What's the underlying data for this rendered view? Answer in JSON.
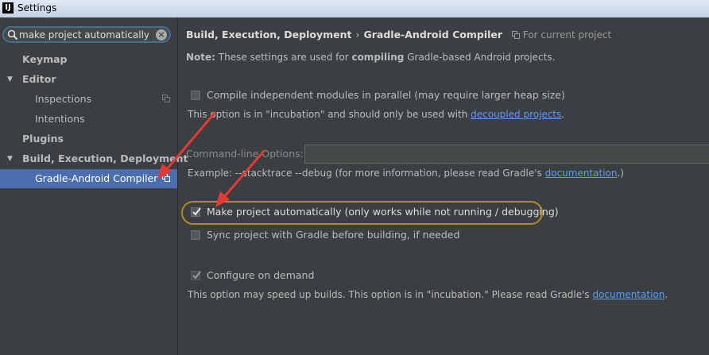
{
  "window": {
    "title": "Settings",
    "app_icon": "IJ"
  },
  "search": {
    "value": "make project automatically"
  },
  "tree": {
    "keymap": "Keymap",
    "editor": "Editor",
    "inspections": "Inspections",
    "intentions": "Intentions",
    "plugins": "Plugins",
    "build": "Build, Execution, Deployment",
    "gradle_android": "Gradle-Android Compiler"
  },
  "breadcrumb": {
    "part1": "Build, Execution, Deployment",
    "separator": "›",
    "part2": "Gradle-Android Compiler",
    "scope": "For current project"
  },
  "note": {
    "prefix": "Note:",
    "text1": "These settings are used for",
    "emph": "compiling",
    "text2": "Gradle-based Android projects."
  },
  "options": {
    "parallel": {
      "label": "Compile independent modules in parallel (may require larger heap size)",
      "checked": false,
      "help_text": "This option is in \"incubation\" and should only be used with",
      "help_link": "decoupled projects",
      "help_end": "."
    },
    "cmdline": {
      "label": "Command-line Options:",
      "value": "",
      "example_text": "Example: --stacktrace --debug (for more information, please read Gradle's",
      "example_link": "documentation",
      "example_end": ".)"
    },
    "make_auto": {
      "label": "Make project automatically (only works while not running / debugging)",
      "checked": true
    },
    "sync": {
      "label": "Sync project with Gradle before building, if needed",
      "checked": false
    },
    "configure": {
      "label": "Configure on demand",
      "checked": true,
      "help_text": "This option may speed up builds. This option is in \"incubation.\" Please read Gradle's",
      "help_link": "documentation",
      "help_end": "."
    }
  },
  "colors": {
    "accent": "#4b6eaf",
    "highlight_ring": "#b08b2a",
    "arrow": "#e53935",
    "link": "#589df6"
  }
}
